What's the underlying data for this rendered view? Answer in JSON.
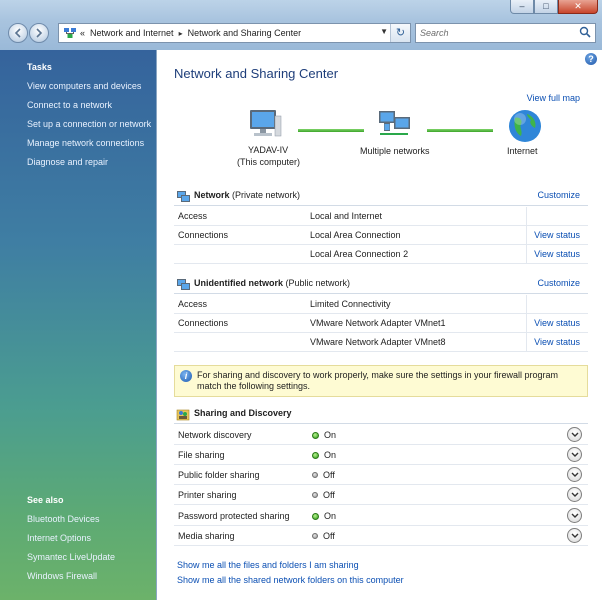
{
  "window": {
    "minimize": "–",
    "maximize": "□",
    "close": "✕"
  },
  "address": {
    "chevrons": "«",
    "crumb1": "Network and Internet",
    "crumb2": "Network and Sharing Center",
    "search_placeholder": "Search"
  },
  "sidebar": {
    "tasks_heading": "Tasks",
    "tasks": [
      "View computers and devices",
      "Connect to a network",
      "Set up a connection or network",
      "Manage network connections",
      "Diagnose and repair"
    ],
    "see_also_heading": "See also",
    "see_also": [
      "Bluetooth Devices",
      "Internet Options",
      "Symantec LiveUpdate",
      "Windows Firewall"
    ]
  },
  "main": {
    "title": "Network and Sharing Center",
    "view_full_map": "View full map",
    "map": {
      "computer_name": "YADAV-IV",
      "computer_sub": "(This computer)",
      "middle": "Multiple networks",
      "internet": "Internet"
    },
    "networks": [
      {
        "name": "Network",
        "type": "(Private network)",
        "customize": "Customize",
        "access_label": "Access",
        "access_value": "Local and Internet",
        "connections_label": "Connections",
        "connections": [
          {
            "name": "Local Area Connection",
            "action": "View status"
          },
          {
            "name": "Local Area Connection 2",
            "action": "View status"
          }
        ]
      },
      {
        "name": "Unidentified network",
        "type": "(Public network)",
        "customize": "Customize",
        "access_label": "Access",
        "access_value": "Limited Connectivity",
        "connections_label": "Connections",
        "connections": [
          {
            "name": "VMware Network Adapter VMnet1",
            "action": "View status"
          },
          {
            "name": "VMware Network Adapter VMnet8",
            "action": "View status"
          }
        ]
      }
    ],
    "notice": "For sharing and discovery to work properly, make sure the settings in your firewall program match the following settings.",
    "sharing_title": "Sharing and Discovery",
    "sharing": [
      {
        "label": "Network discovery",
        "state": "On"
      },
      {
        "label": "File sharing",
        "state": "On"
      },
      {
        "label": "Public folder sharing",
        "state": "Off"
      },
      {
        "label": "Printer sharing",
        "state": "Off"
      },
      {
        "label": "Password protected sharing",
        "state": "On"
      },
      {
        "label": "Media sharing",
        "state": "Off"
      }
    ],
    "footer_links": [
      "Show me all the files and folders I am sharing",
      "Show me all the shared network folders on this computer"
    ],
    "colors": {
      "link": "#0b4fb3",
      "title": "#1e3e7a",
      "on": "#2e9b19",
      "off": "#8c8c8c"
    },
    "icons": {
      "help": "?",
      "info": "i"
    }
  }
}
